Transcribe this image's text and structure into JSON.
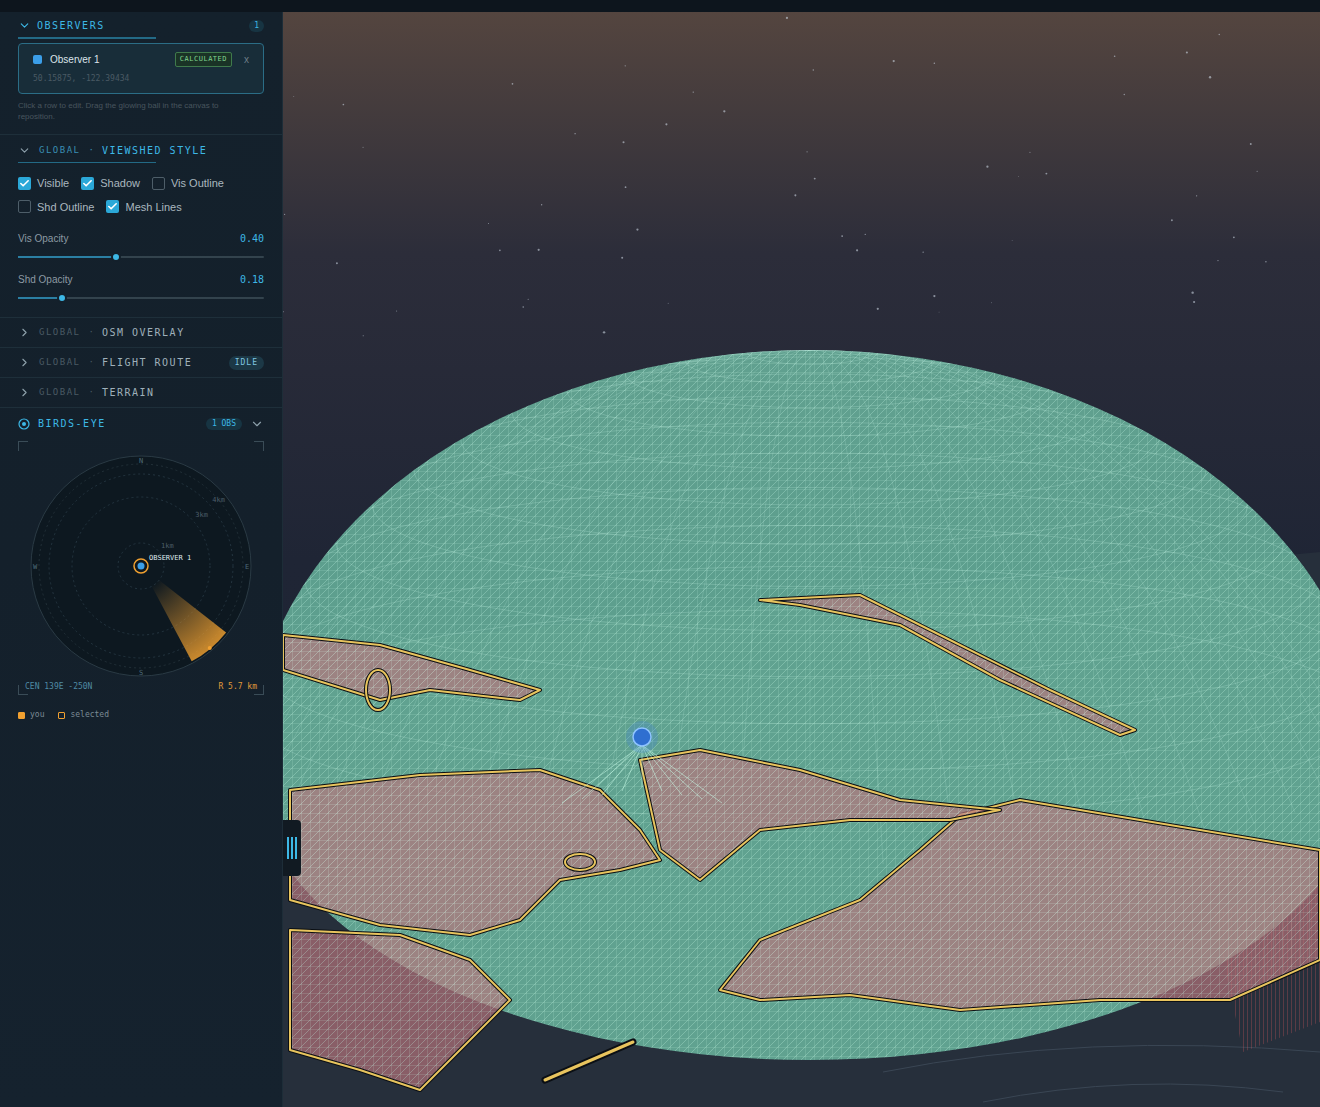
{
  "observers": {
    "title": "OBSERVERS",
    "count": "1",
    "items": [
      {
        "name": "Observer 1",
        "status": "CALCULATED",
        "close": "x",
        "coords": "50.15875, -122.39434",
        "selected": true,
        "color": "#3b9ee8"
      }
    ],
    "hint": "Click a row to edit. Drag the glowing ball in the canvas to reposition."
  },
  "viewshed_style": {
    "scope": "GLOBAL",
    "separator": "·",
    "title": "VIEWSHED STYLE",
    "expanded": true,
    "toggles": [
      {
        "label": "Visible",
        "checked": true
      },
      {
        "label": "Shadow",
        "checked": true
      },
      {
        "label": "Vis Outline",
        "checked": false
      },
      {
        "label": "Shd Outline",
        "checked": false
      },
      {
        "label": "Mesh Lines",
        "checked": true
      }
    ],
    "sliders": [
      {
        "label": "Vis Opacity",
        "reading": "0.40",
        "level": 0.4
      },
      {
        "label": "Shd Opacity",
        "reading": "0.18",
        "level": 0.18
      }
    ]
  },
  "sections": [
    {
      "scope": "GLOBAL",
      "separator": "·",
      "title": "OSM OVERLAY",
      "expanded": false
    },
    {
      "scope": "GLOBAL",
      "separator": "·",
      "title": "FLIGHT ROUTE",
      "expanded": false,
      "badge": "IDLE"
    },
    {
      "scope": "GLOBAL",
      "separator": "·",
      "title": "TERRAIN",
      "expanded": false
    }
  ],
  "birds_eye": {
    "title": "BIRDS-EYE",
    "badge": "1 OBS",
    "expanded": true,
    "compass": [
      {
        "label": "N",
        "angle": 270
      },
      {
        "label": "E",
        "angle": 0
      },
      {
        "label": "S",
        "angle": 90
      },
      {
        "label": "W",
        "angle": 180
      }
    ],
    "rings": [
      {
        "label": "1km",
        "km": 1
      },
      {
        "label": "3km",
        "km": 3
      },
      {
        "label": "4km",
        "km": 4
      }
    ],
    "observer_label": "OBSERVER 1",
    "center": "CEN 139E -250N",
    "radius": "R 5.7 km",
    "legend": [
      {
        "label": "you",
        "kind": "filled",
        "color": "#f0a030"
      },
      {
        "label": "selected",
        "kind": "outline",
        "color": "#f0a030"
      }
    ]
  }
}
